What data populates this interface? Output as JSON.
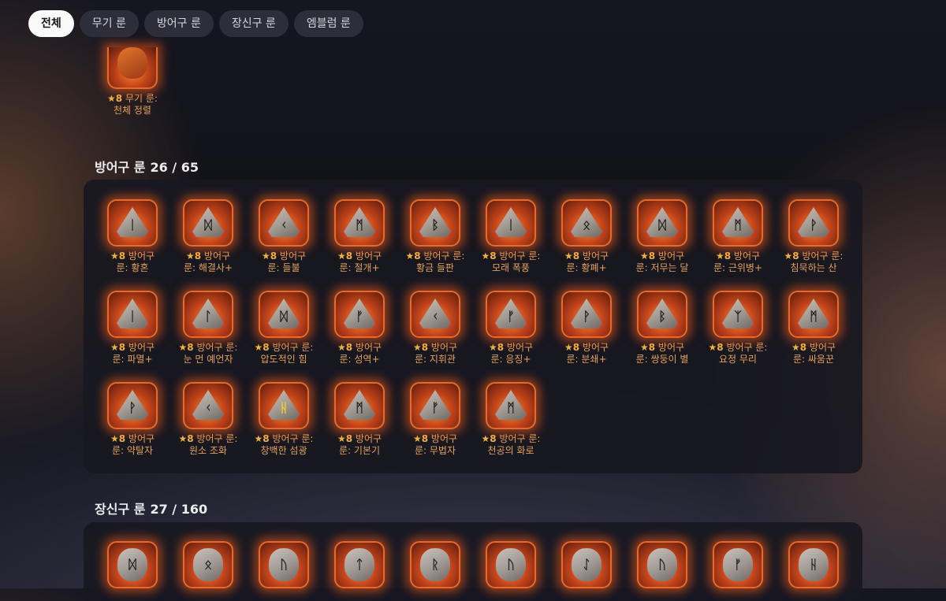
{
  "tabs": [
    {
      "label": "전체",
      "active": true
    },
    {
      "label": "무기 룬",
      "active": false
    },
    {
      "label": "방어구 룬",
      "active": false
    },
    {
      "label": "장신구 룬",
      "active": false
    },
    {
      "label": "엠블럼 룬",
      "active": false
    }
  ],
  "partial_top": {
    "star": "★8",
    "label": "무기 룬:\n천체 정렬"
  },
  "armor": {
    "title": "방어구 룬",
    "count": "26 / 65",
    "runes": [
      {
        "star": "★8",
        "label": "방어구\n룬: 황혼",
        "glyph": "ᛁ"
      },
      {
        "star": "★8",
        "label": "방어구\n룬: 해결사+",
        "glyph": "ᛞ"
      },
      {
        "star": "★8",
        "label": "방어구\n룬: 들불",
        "glyph": "ᚲ"
      },
      {
        "star": "★8",
        "label": "방어구\n룬: 절개+",
        "glyph": "ᛗ"
      },
      {
        "star": "★8",
        "label": "방어구 룬:\n황금 들판",
        "glyph": "ᛒ"
      },
      {
        "star": "★8",
        "label": "방어구 룬:\n모래 폭풍",
        "glyph": "ᛁ"
      },
      {
        "star": "★8",
        "label": "방어구\n룬: 황폐+",
        "glyph": "ᛟ"
      },
      {
        "star": "★8",
        "label": "방어구\n룬: 저무는 달",
        "glyph": "ᛞ"
      },
      {
        "star": "★8",
        "label": "방어구\n룬: 근위병+",
        "glyph": "ᛗ"
      },
      {
        "star": "★8",
        "label": "방어구 룬:\n침묵하는 산",
        "glyph": "ᚹ"
      },
      {
        "star": "★8",
        "label": "방어구\n룬: 파멸+",
        "glyph": "ᛁ"
      },
      {
        "star": "★8",
        "label": "방어구 룬:\n눈 먼 예언자",
        "glyph": "ᛚ"
      },
      {
        "star": "★8",
        "label": "방어구 룬:\n압도적인 힘",
        "glyph": "ᛞ"
      },
      {
        "star": "★8",
        "label": "방어구\n룬: 성역+",
        "glyph": "ᚠ"
      },
      {
        "star": "★8",
        "label": "방어구\n룬: 지휘관",
        "glyph": "ᚲ"
      },
      {
        "star": "★8",
        "label": "방어구\n룬: 응징+",
        "glyph": "ᚠ"
      },
      {
        "star": "★8",
        "label": "방어구\n룬: 분쇄+",
        "glyph": "ᚹ"
      },
      {
        "star": "★8",
        "label": "방어구\n룬: 쌍둥이 별",
        "glyph": "ᛒ"
      },
      {
        "star": "★8",
        "label": "방어구 룬:\n요정 무리",
        "glyph": "ᛉ"
      },
      {
        "star": "★8",
        "label": "방어구\n룬: 싸움꾼",
        "glyph": "ᛗ"
      },
      {
        "star": "★8",
        "label": "방어구\n룬: 약탈자",
        "glyph": "ᚹ"
      },
      {
        "star": "★8",
        "label": "방어구 룬:\n원소 조화",
        "glyph": "ᚲ"
      },
      {
        "star": "★8",
        "label": "방어구 룬:\n창백한 섬광",
        "glyph": "ᚺ",
        "gold": true
      },
      {
        "star": "★8",
        "label": "방어구\n룬: 기본기",
        "glyph": "ᛗ"
      },
      {
        "star": "★8",
        "label": "방어구\n룬: 무법자",
        "glyph": "ᚠ"
      },
      {
        "star": "★8",
        "label": "방어구 룬:\n천공의 화로",
        "glyph": "ᛗ"
      }
    ]
  },
  "accessory": {
    "title": "장신구 룬",
    "count": "27 / 160",
    "runes": [
      {
        "glyph": "ᛞ"
      },
      {
        "glyph": "ᛟ"
      },
      {
        "glyph": "ᚢ"
      },
      {
        "glyph": "ᛏ"
      },
      {
        "glyph": "ᚱ"
      },
      {
        "glyph": "ᚢ"
      },
      {
        "glyph": "ᛇ"
      },
      {
        "glyph": "ᚢ"
      },
      {
        "glyph": "ᚠ"
      },
      {
        "glyph": "ᚺ"
      }
    ]
  }
}
